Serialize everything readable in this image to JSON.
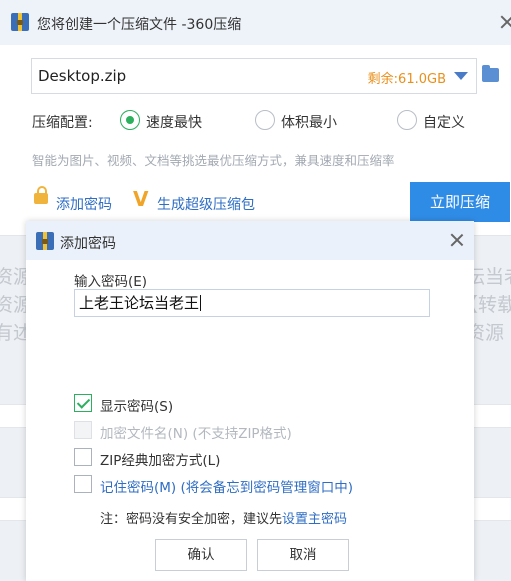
{
  "main_window": {
    "title": "您将创建一个压缩文件 -360压缩",
    "archive_path": "Desktop.zip",
    "free_space": "剩余:61.0GB",
    "config_label": "压缩配置:",
    "options": [
      "速度最快",
      "体积最小",
      "自定义"
    ],
    "selected_option": "速度最快",
    "hint": "智能为图片、视频、文档等挑选最优压缩方式，兼具速度和压缩率",
    "add_password_link": "添加密码",
    "super_package_link": "生成超级压缩包",
    "compress_button": "立即压缩"
  },
  "dialog": {
    "title": "添加密码",
    "input_label": "输入密码(E)",
    "password_value": "上老王论坛当老王",
    "checkboxes": [
      {
        "label": "显示密码(S)",
        "checked": true,
        "disabled": false
      },
      {
        "label": "加密文件名(N) (不支持ZIP格式)",
        "checked": false,
        "disabled": true
      },
      {
        "label": "ZIP经典加密方式(L)",
        "checked": false,
        "disabled": false
      },
      {
        "label": "记住密码(M) (将会备忘到密码管理窗口中)",
        "checked": false,
        "disabled": false
      }
    ],
    "note_prefix": "注：密码没有安全加密，建议先",
    "note_link": "设置主密码",
    "ok_button": "确认",
    "cancel_button": "取消"
  },
  "background_page": {
    "left_fragments": [
      "资源",
      "资源",
      "有述"
    ],
    "right_fragments": [
      "坛当老",
      "【转载",
      "资源"
    ]
  },
  "colors": {
    "accent": "#2f8ce6",
    "link": "#2f6ec4",
    "check_green": "#2bb05e",
    "free_space_orange": "#e8901b"
  }
}
